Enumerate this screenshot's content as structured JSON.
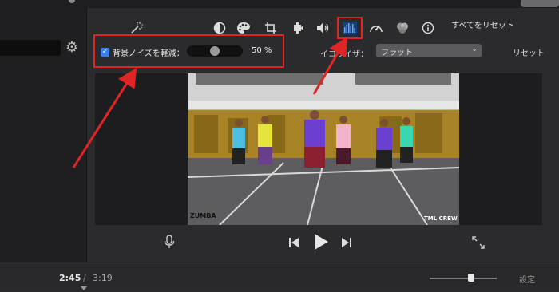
{
  "toolbar": {
    "tools": [
      {
        "icon": "magic-wand-icon"
      },
      {
        "icon": "color-balance-icon"
      },
      {
        "icon": "color-palette-icon"
      },
      {
        "icon": "crop-icon"
      },
      {
        "icon": "stabilization-camera-icon"
      },
      {
        "icon": "volume-icon"
      },
      {
        "icon": "noise-reduction-equalizer-icon",
        "selected": true
      },
      {
        "icon": "speed-gauge-icon"
      },
      {
        "icon": "clip-filter-icon"
      },
      {
        "icon": "info-icon"
      }
    ],
    "reset_all_label": "すべてをリセット"
  },
  "noise_reduction": {
    "checked": true,
    "label": "背景ノイズを軽減：",
    "value_text": "50 %",
    "level": 0.5
  },
  "equalizer": {
    "label": "イコライザ：",
    "selected": "フラット",
    "reset_label": "リセット"
  },
  "video": {
    "watermark_left": "ZUMBA",
    "watermark_right": "TML CREW"
  },
  "timeline": {
    "current_time": "2:45",
    "separator": "/",
    "total_time": "3:19",
    "settings_label": "設定",
    "zoom_level": 0.62
  },
  "colors": {
    "highlight": "#e02525",
    "checkbox": "#3a7ff0"
  }
}
